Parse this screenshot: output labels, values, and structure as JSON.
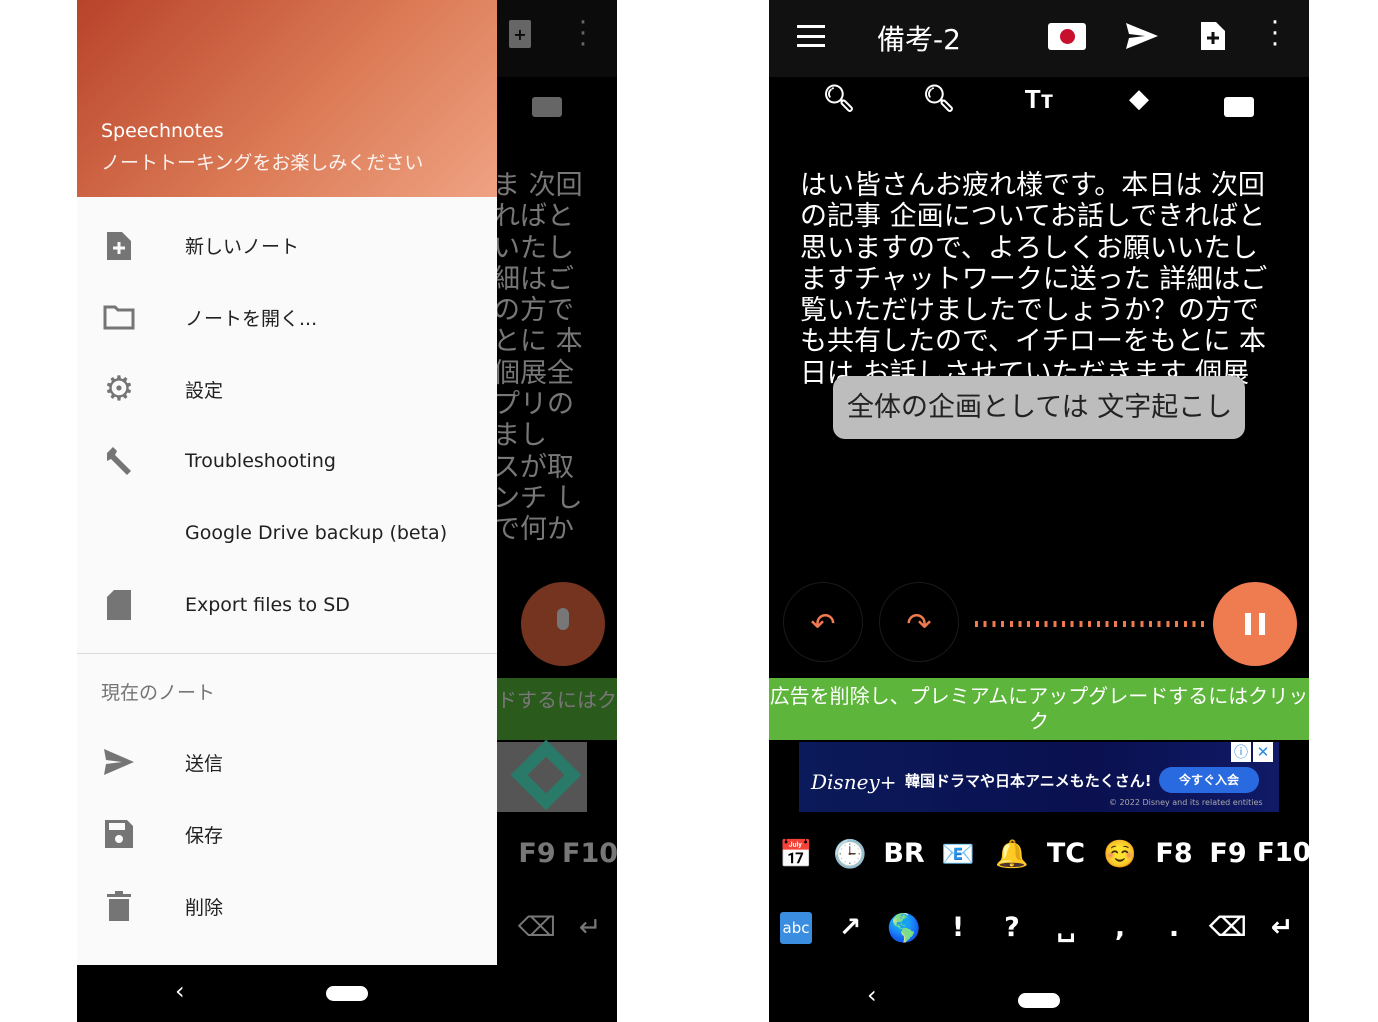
{
  "left": {
    "header": {
      "app_name": "Speechnotes",
      "tagline": "ノートトーキングをお楽しみください"
    },
    "menu": [
      {
        "icon": "note-add-icon",
        "label": "新しいノート"
      },
      {
        "icon": "folder-icon",
        "label": "ノートを開く..."
      },
      {
        "icon": "gear-icon",
        "label": "設定"
      },
      {
        "icon": "wrench-icon",
        "label": "Troubleshooting"
      },
      {
        "icon": "",
        "label": "Google Drive backup (beta)"
      },
      {
        "icon": "sd-card-icon",
        "label": "Export files to SD"
      }
    ],
    "section_label": "現在のノート",
    "note_menu": [
      {
        "icon": "send-icon",
        "label": "送信"
      },
      {
        "icon": "save-icon",
        "label": "保存"
      },
      {
        "icon": "trash-icon",
        "label": "削除"
      }
    ],
    "bg_text_lines": [
      "ま 次回",
      "ればと",
      "いたし",
      "細はご",
      "の方で",
      "とに 本",
      "個展全",
      "プリの",
      "まし",
      "スが取",
      "ンチ し",
      "で何か"
    ],
    "bg_banner": "ドするにはク",
    "bg_keys": [
      "F9",
      "F10"
    ]
  },
  "right": {
    "title": "備考-2",
    "note_text": "はい皆さんお疲れ様です。本日は 次回の記事 企画についてお話しできればと思いますので、よろしくお願いいたしますチャットワークに送った 詳細はご覧いただけましたでしょうか？の方でも共有したので、イチローをもとに 本日は お話しさせていただきます 個展",
    "interim_text": "全体の企画としては 文字起こし",
    "upgrade_banner": "広告を削除し、プレミアムにアップグレードするにはクリック",
    "ad": {
      "brand": "Disney+",
      "headline": "韓国ドラマや日本アニメもたくさん!",
      "cta": "今すぐ入会",
      "copyright": "© 2022 Disney and its related entities"
    },
    "keys_row1": [
      "📅",
      "🕒",
      "BR",
      "📧",
      "🔔",
      "TC",
      "☺️",
      "F8",
      "F9",
      "F10"
    ],
    "keys_row2": [
      "abc",
      "↗",
      "🌎",
      "!",
      "?",
      "␣",
      ",",
      ".",
      "⌫",
      "↵"
    ],
    "accent": "#ef7b50",
    "green": "#5db63b"
  }
}
